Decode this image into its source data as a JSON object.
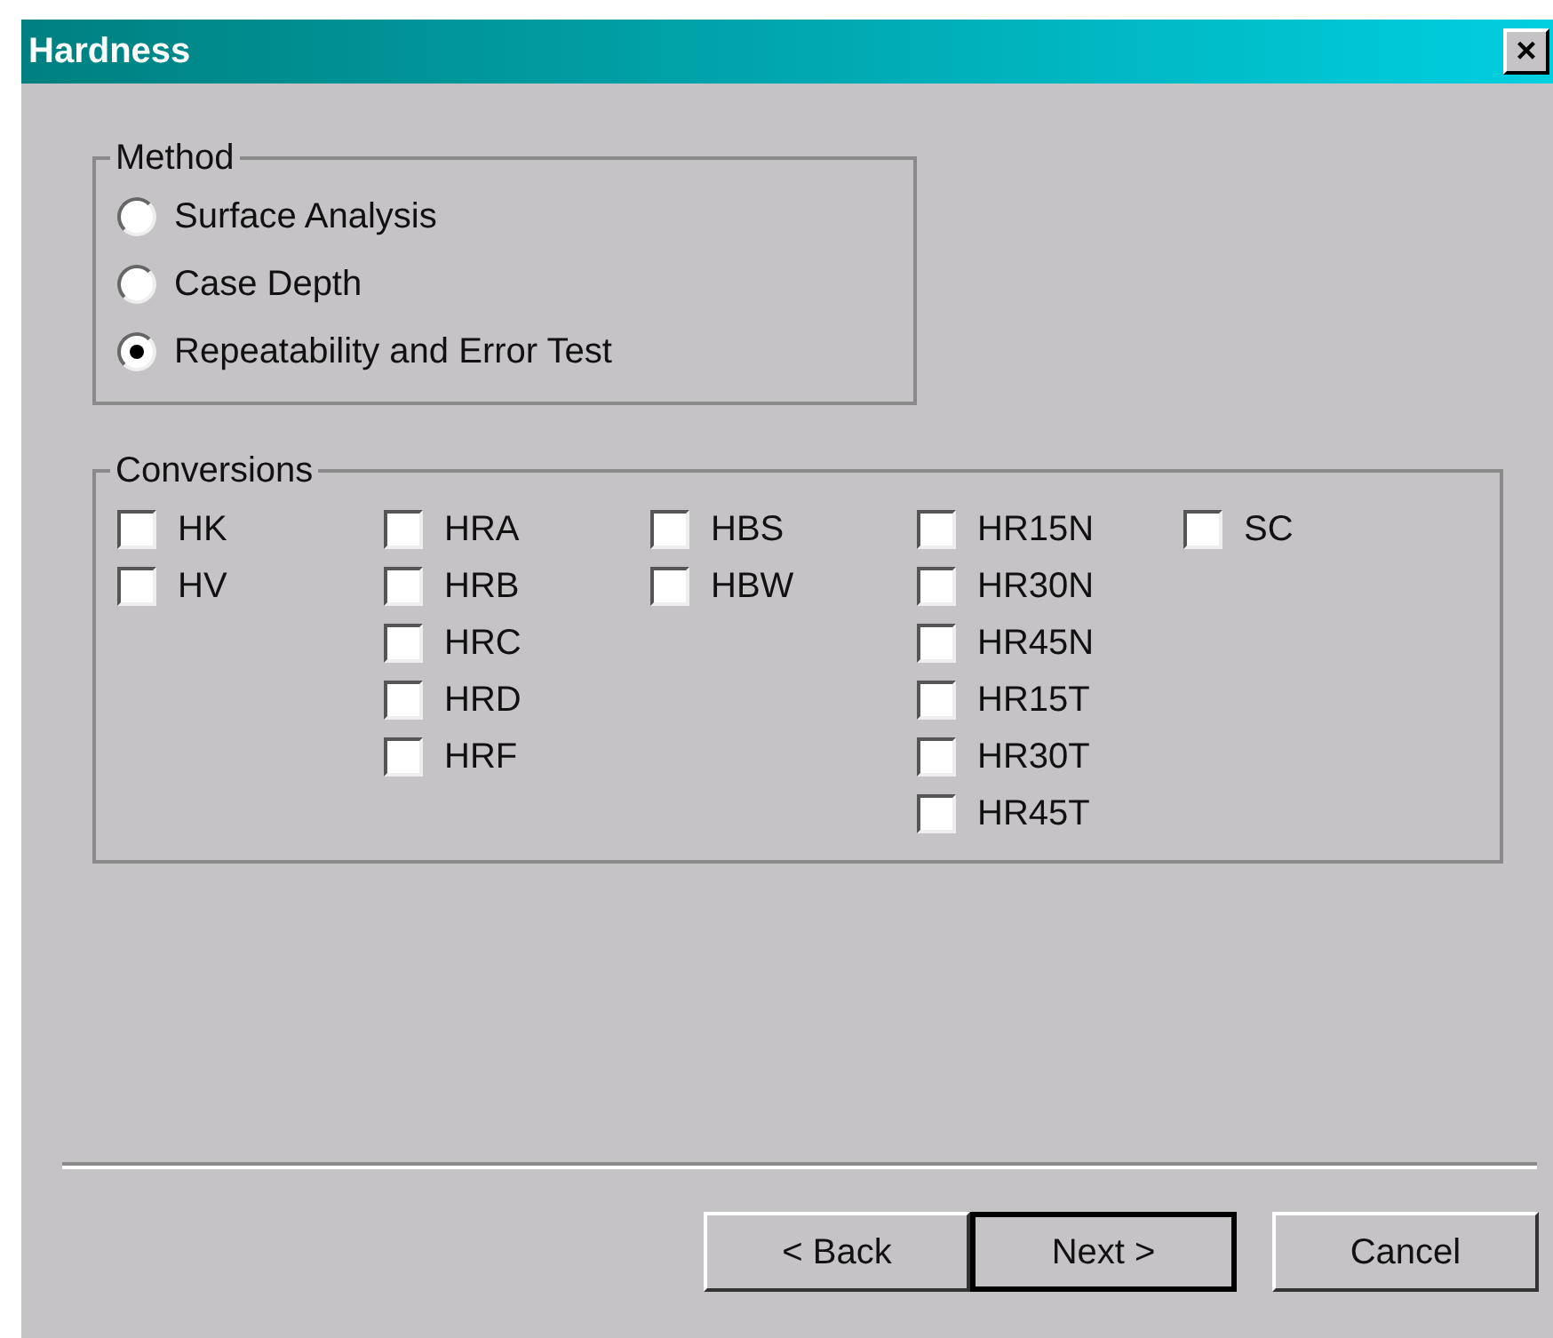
{
  "window": {
    "title": "Hardness",
    "close": "×"
  },
  "method": {
    "label": "Method",
    "options": [
      {
        "label": "Surface Analysis",
        "selected": false
      },
      {
        "label": "Case Depth",
        "selected": false
      },
      {
        "label": "Repeatability and Error Test",
        "selected": true
      }
    ]
  },
  "conversions": {
    "label": "Conversions",
    "columns": [
      [
        {
          "label": "HK",
          "checked": false
        },
        {
          "label": "HV",
          "checked": false
        }
      ],
      [
        {
          "label": "HRA",
          "checked": false
        },
        {
          "label": "HRB",
          "checked": false
        },
        {
          "label": "HRC",
          "checked": false
        },
        {
          "label": "HRD",
          "checked": false
        },
        {
          "label": "HRF",
          "checked": false
        }
      ],
      [
        {
          "label": "HBS",
          "checked": false
        },
        {
          "label": "HBW",
          "checked": false
        }
      ],
      [
        {
          "label": "HR15N",
          "checked": false
        },
        {
          "label": "HR30N",
          "checked": false
        },
        {
          "label": "HR45N",
          "checked": false
        },
        {
          "label": "HR15T",
          "checked": false
        },
        {
          "label": "HR30T",
          "checked": false
        },
        {
          "label": "HR45T",
          "checked": false
        }
      ],
      [
        {
          "label": "SC",
          "checked": false
        }
      ]
    ]
  },
  "buttons": [
    {
      "label": "< Back",
      "default": false
    },
    {
      "label": "Next >",
      "default": true
    },
    {
      "label": "Cancel",
      "default": false
    }
  ]
}
